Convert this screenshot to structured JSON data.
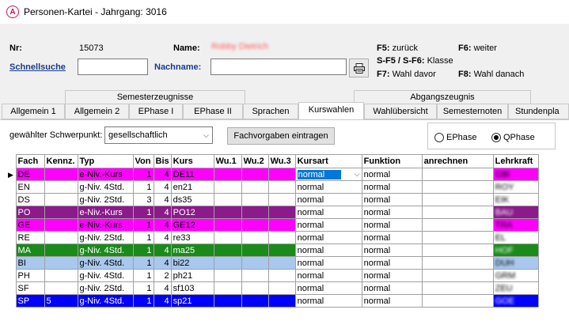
{
  "window": {
    "title": "Personen-Kartei - Jahrgang: 3016",
    "icon": "app-logo-icon"
  },
  "header": {
    "nr_label": "Nr:",
    "nr_value": "15073",
    "name_label": "Name:",
    "name_value": "Robby Dietrich",
    "schnellsuche_label": "Schnellsuche",
    "schnellsuche_value": "",
    "nachname_label": "Nachname:",
    "nachname_value": "",
    "print_icon": "printer-icon",
    "f5_key": "F5:",
    "f5_text": "zurück",
    "f6_key": "F6:",
    "f6_text": "weiter",
    "sf5_key": "S-F5 / S-F6:",
    "sf5_text": "Klasse",
    "f7_key": "F7:",
    "f7_text": "Wahl davor",
    "f8_key": "F8:",
    "f8_text": "Wahl danach"
  },
  "tabs": {
    "group1": "Semesterzeugnisse",
    "group2": "Abgangszeugnis",
    "items": [
      "Allgemein 1",
      "Allgemein 2",
      "EPhase I",
      "EPhase II",
      "Sprachen",
      "Kurswahlen",
      "Wahlübersicht",
      "Semesternoten",
      "Stundenpla"
    ],
    "active": "Kurswahlen"
  },
  "kurswahlen": {
    "schwerpunkt_label": "gewählter Schwerpunkt:",
    "schwerpunkt_value": "gesellschaftlich",
    "fachvorgaben_button": "Fachvorgaben eintragen",
    "radio_ephase": "EPhase",
    "radio_qphase": "QPhase",
    "radio_selected": "QPhase"
  },
  "table": {
    "columns": [
      "Fach",
      "Kennz.",
      "Typ",
      "Von",
      "Bis",
      "Kurs",
      "Wu.1",
      "Wu.2",
      "Wu.3",
      "Kursart",
      "Funktion",
      "anrechnen",
      "Lehrkraft"
    ],
    "rows": [
      {
        "fach": "DE",
        "kennz": "",
        "typ": "e-Niv.-Kurs",
        "von": "1",
        "bis": "4",
        "kurs": "DE11",
        "wu1": "",
        "wu2": "",
        "wu3": "",
        "kursart": "normal",
        "funktion": "normal",
        "anrechnen": "",
        "lehrkraft": "GBl",
        "color": "#ff00ff",
        "fg": "#000000"
      },
      {
        "fach": "EN",
        "kennz": "",
        "typ": "g-Niv. 4Std.",
        "von": "1",
        "bis": "4",
        "kurs": "en21",
        "wu1": "",
        "wu2": "",
        "wu3": "",
        "kursart": "normal",
        "funktion": "normal",
        "anrechnen": "",
        "lehrkraft": "ROY",
        "color": "#ffffff",
        "fg": "#000000"
      },
      {
        "fach": "DS",
        "kennz": "",
        "typ": "g-Niv. 2Std.",
        "von": "3",
        "bis": "4",
        "kurs": "ds35",
        "wu1": "",
        "wu2": "",
        "wu3": "",
        "kursart": "normal",
        "funktion": "normal",
        "anrechnen": "",
        "lehrkraft": "EIK",
        "color": "#ffffff",
        "fg": "#000000"
      },
      {
        "fach": "PO",
        "kennz": "",
        "typ": "e-Niv.-Kurs",
        "von": "1",
        "bis": "4",
        "kurs": "PO12",
        "wu1": "",
        "wu2": "",
        "wu3": "",
        "kursart": "normal",
        "funktion": "normal",
        "anrechnen": "",
        "lehrkraft": "BAU",
        "color": "#8b1a8b",
        "fg": "#ffffff"
      },
      {
        "fach": "GE",
        "kennz": "",
        "typ": "e-Niv.-Kurs",
        "von": "1",
        "bis": "4",
        "kurs": "GE12",
        "wu1": "",
        "wu2": "",
        "wu3": "",
        "kursart": "normal",
        "funktion": "normal",
        "anrechnen": "",
        "lehrkraft": "TRA",
        "color": "#ff00ff",
        "fg": "#000000"
      },
      {
        "fach": "RE",
        "kennz": "",
        "typ": "g-Niv. 2Std.",
        "von": "1",
        "bis": "4",
        "kurs": "re33",
        "wu1": "",
        "wu2": "",
        "wu3": "",
        "kursart": "normal",
        "funktion": "normal",
        "anrechnen": "",
        "lehrkraft": "EL",
        "color": "#ffffff",
        "fg": "#000000"
      },
      {
        "fach": "MA",
        "kennz": "",
        "typ": "g-Niv. 4Std.",
        "von": "1",
        "bis": "4",
        "kurs": "ma25",
        "wu1": "",
        "wu2": "",
        "wu3": "",
        "kursart": "normal",
        "funktion": "normal",
        "anrechnen": "",
        "lehrkraft": "HOF",
        "color": "#1a8a1a",
        "fg": "#ffffff"
      },
      {
        "fach": "BI",
        "kennz": "",
        "typ": "g-Niv. 4Std.",
        "von": "1",
        "bis": "4",
        "kurs": "bi22",
        "wu1": "",
        "wu2": "",
        "wu3": "",
        "kursart": "normal",
        "funktion": "normal",
        "anrechnen": "",
        "lehrkraft": "DUH",
        "color": "#a8c8f0",
        "fg": "#000000"
      },
      {
        "fach": "PH",
        "kennz": "",
        "typ": "g-Niv. 4Std.",
        "von": "1",
        "bis": "2",
        "kurs": "ph21",
        "wu1": "",
        "wu2": "",
        "wu3": "",
        "kursart": "normal",
        "funktion": "normal",
        "anrechnen": "",
        "lehrkraft": "GRM",
        "color": "#ffffff",
        "fg": "#000000"
      },
      {
        "fach": "SF",
        "kennz": "",
        "typ": "g-Niv. 2Std.",
        "von": "1",
        "bis": "4",
        "kurs": "sf103",
        "wu1": "",
        "wu2": "",
        "wu3": "",
        "kursart": "normal",
        "funktion": "normal",
        "anrechnen": "",
        "lehrkraft": "ZEU",
        "color": "#ffffff",
        "fg": "#000000"
      },
      {
        "fach": "SP",
        "kennz": "5",
        "typ": "g-Niv. 4Std.",
        "von": "1",
        "bis": "4",
        "kurs": "sp21",
        "wu1": "",
        "wu2": "",
        "wu3": "",
        "kursart": "normal",
        "funktion": "normal",
        "anrechnen": "",
        "lehrkraft": "GOE",
        "color": "#0000ff",
        "fg": "#ffffff"
      }
    ]
  }
}
